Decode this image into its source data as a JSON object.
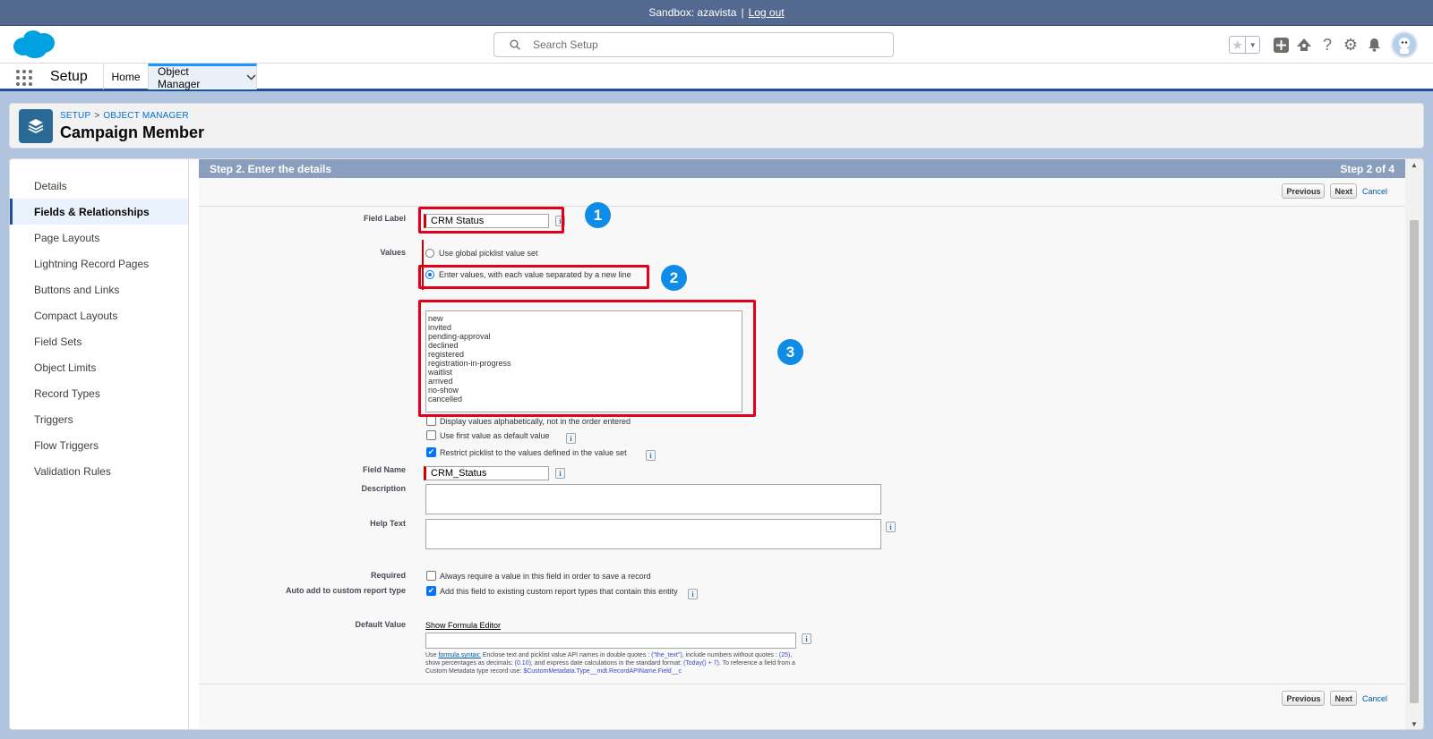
{
  "sandbox": {
    "label": "Sandbox: azavista",
    "separator": "|",
    "logout": "Log out"
  },
  "header": {
    "search_placeholder": "Search Setup"
  },
  "app_nav": {
    "app_name": "Setup",
    "tabs": [
      {
        "label": "Home"
      },
      {
        "label": "Object Manager"
      }
    ]
  },
  "page": {
    "breadcrumb": [
      "SETUP",
      "OBJECT MANAGER"
    ],
    "breadcrumb_sep": ">",
    "title": "Campaign Member"
  },
  "sidebar": {
    "items": [
      {
        "label": "Details"
      },
      {
        "label": "Fields & Relationships"
      },
      {
        "label": "Page Layouts"
      },
      {
        "label": "Lightning Record Pages"
      },
      {
        "label": "Buttons and Links"
      },
      {
        "label": "Compact Layouts"
      },
      {
        "label": "Field Sets"
      },
      {
        "label": "Object Limits"
      },
      {
        "label": "Record Types"
      },
      {
        "label": "Triggers"
      },
      {
        "label": "Flow Triggers"
      },
      {
        "label": "Validation Rules"
      }
    ]
  },
  "step": {
    "title": "Step 2. Enter the details",
    "counter": "Step 2 of 4"
  },
  "buttons": {
    "previous": "Previous",
    "next": "Next",
    "cancel": "Cancel"
  },
  "form": {
    "field_label": {
      "label": "Field Label",
      "value": "CRM Status"
    },
    "values": {
      "label": "Values",
      "option_global": "Use global picklist value set",
      "option_enter": "Enter values, with each value separated by a new line",
      "list": [
        "new",
        "invited",
        "pending-approval",
        "declined",
        "registered",
        "registration-in-progress",
        "waitlist",
        "arrived",
        "no-show",
        "cancelled"
      ]
    },
    "chk_alpha": "Display values alphabetically, not in the order entered",
    "chk_first_default": "Use first value as default value",
    "chk_restrict": "Restrict picklist to the values defined in the value set",
    "field_name": {
      "label": "Field Name",
      "value": "CRM_Status"
    },
    "description": {
      "label": "Description"
    },
    "help_text": {
      "label": "Help Text"
    },
    "required": {
      "label": "Required",
      "text": "Always require a value in this field in order to save a record"
    },
    "auto_add": {
      "label": "Auto add to custom report type",
      "text": "Add this field to existing custom report types that contain this entity"
    },
    "default_value": {
      "label": "Default Value",
      "formula_link": "Show Formula Editor",
      "hint_use": "Use ",
      "hint_syntax": "formula syntax:",
      "hint_1": " Enclose text and picklist value API names in double quotes : ",
      "hint_code1": "(\"the_text\")",
      "hint_2": ", include numbers without quotes : ",
      "hint_code2": "(25)",
      "hint_3": ", show percentages as decimals: ",
      "hint_code3": "(0.10)",
      "hint_4": ", and express date calculations in the standard format: ",
      "hint_code4": "(Today() + 7)",
      "hint_5": ". To reference a field from a Custom Metadata type record use: ",
      "hint_code5": "$CustomMetadata.Type__mdt.RecordAPIName.Field__c"
    }
  },
  "annotations": [
    {
      "number": "1"
    },
    {
      "number": "2"
    },
    {
      "number": "3"
    }
  ],
  "colors": {
    "highlight": "#e2001a",
    "badge": "#0f8ce6",
    "brand": "#1b5297",
    "sandbox_bar": "#53698f"
  }
}
